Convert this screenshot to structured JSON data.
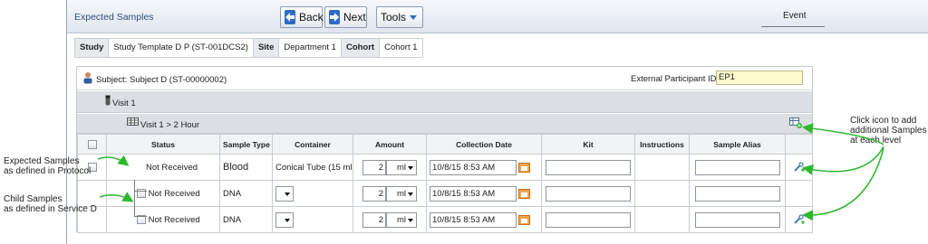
{
  "page_title": "Expected Samples",
  "toolbar": {
    "back": "Back",
    "next": "Next",
    "tools": "Tools",
    "event": "Event"
  },
  "context": [
    {
      "label": "Study",
      "value": "Study Template D P (ST-001DCS2)"
    },
    {
      "label": "Site",
      "value": "Department 1"
    },
    {
      "label": "Cohort",
      "value": "Cohort 1"
    }
  ],
  "subject": {
    "label": "Subject: Subject D (ST-00000002)",
    "ext_label": "External Participant ID",
    "ext_value": "EP1"
  },
  "visit": "Visit 1",
  "sub_visit": "Visit 1 > 2 Hour",
  "table": {
    "headers": [
      "",
      "Status",
      "Sample Type",
      "Container",
      "Amount",
      "Collection Date",
      "Kit",
      "Instructions",
      "Sample Alias",
      ""
    ],
    "rows": [
      {
        "status": "Not Received",
        "type": "Blood",
        "container": "Conical Tube (15 ml)",
        "amount": "2",
        "unit": "ml",
        "date": "10/8/15 8:53 AM"
      },
      {
        "status": "Not Received",
        "type": "DNA",
        "container": "",
        "amount": "2",
        "unit": "ml",
        "date": "10/8/15 8:53 AM"
      },
      {
        "status": "Not Received",
        "type": "DNA",
        "container": "",
        "amount": "2",
        "unit": "ml",
        "date": "10/8/15 8:53 AM"
      }
    ]
  },
  "annotations": {
    "expected": [
      "Expected Samples",
      "as defined in Protocol"
    ],
    "child": [
      "Child Samples",
      "as defined in Service D"
    ],
    "click": [
      "Click icon to add",
      "additional Samples",
      "at each level"
    ]
  },
  "colors": {
    "accent": "#2d6cc0",
    "arrow": "#2eb82e",
    "highlight_input": "#fffbd0"
  }
}
